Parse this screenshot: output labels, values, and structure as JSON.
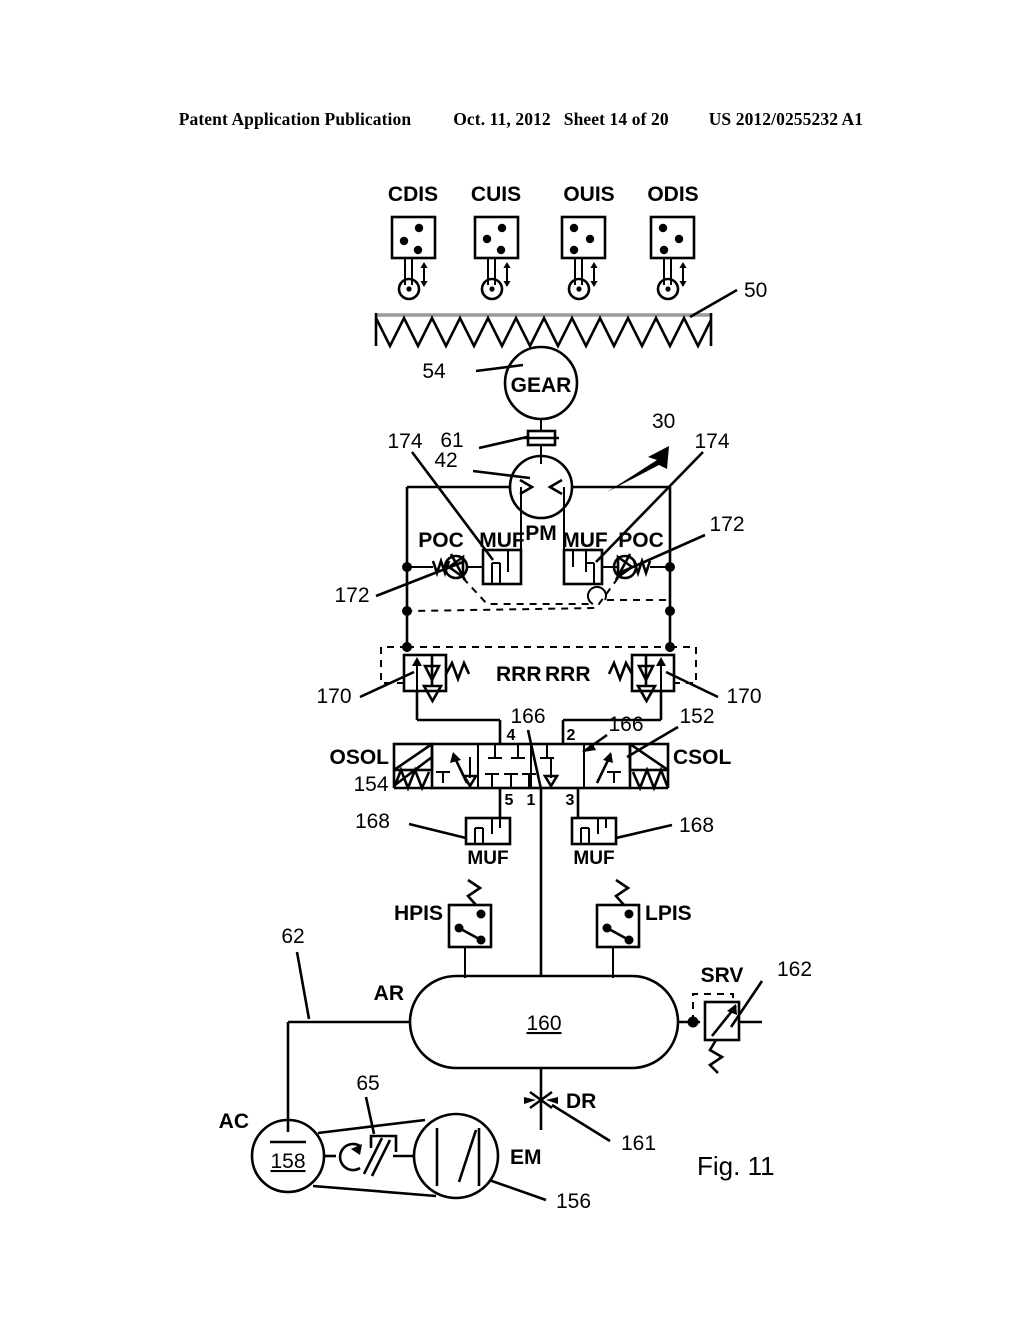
{
  "header": {
    "publication": "Patent Application Publication",
    "date": "Oct. 11, 2012",
    "sheet": "Sheet 14 of 20",
    "number": "US 2012/0255232 A1"
  },
  "figure": {
    "caption": "Fig. 11"
  },
  "sensors": [
    {
      "label": "CDIS",
      "dots": [
        [
          0.28,
          0.58
        ],
        [
          0.62,
          0.26
        ],
        [
          0.6,
          0.8
        ]
      ]
    },
    {
      "label": "CUIS",
      "dots": [
        [
          0.28,
          0.52
        ],
        [
          0.62,
          0.26
        ],
        [
          0.6,
          0.8
        ]
      ]
    },
    {
      "label": "OUIS",
      "dots": [
        [
          0.28,
          0.26
        ],
        [
          0.62,
          0.52
        ],
        [
          0.28,
          0.8
        ]
      ]
    },
    {
      "label": "ODIS",
      "dots": [
        [
          0.28,
          0.24
        ],
        [
          0.64,
          0.5
        ],
        [
          0.3,
          0.78
        ]
      ]
    }
  ],
  "components": {
    "rack": "50",
    "gear": "GEAR",
    "gear_ref": "54",
    "coupling_ref": "61",
    "motor": "PM",
    "motor_ref": "42",
    "system_ref": "30",
    "poc_left": "POC",
    "poc_right": "POC",
    "muf_top_left": "MUF",
    "muf_top_right": "MUF",
    "poc_ref_left": "172",
    "poc_ref_right": "172",
    "muf_ref_left": "174",
    "muf_ref_right": "174",
    "rrr_left": "RRR",
    "rrr_right": "RRR",
    "rrr_ref_left": "170",
    "rrr_ref_right": "170",
    "line_ref_left": "166",
    "line_ref_right": "166",
    "valve_ref": "152",
    "osol": "OSOL",
    "csol": "CSOL",
    "osol_ref": "154",
    "muf_bottom_left": "MUF",
    "muf_bottom_right": "MUF",
    "muf_bottom_ref_left": "168",
    "muf_bottom_ref_right": "168",
    "hpis": "HPIS",
    "lpis": "LPIS",
    "tank_label": "AR",
    "tank_ref": "160",
    "tank_line_ref": "62",
    "srv": "SRV",
    "srv_ref": "162",
    "drain": "DR",
    "drain_ref": "161",
    "compressor": "AC",
    "compressor_ref": "158",
    "clutch_ref": "65",
    "motor_em": "EM",
    "motor_em_ref": "156"
  },
  "valve_ports": {
    "top_left": "4",
    "top_right": "2",
    "bottom_left": "5",
    "bottom_mid": "1",
    "bottom_right": "3"
  },
  "colors": {
    "ink": "#000000",
    "paper": "#ffffff",
    "rack_top": "#888888"
  }
}
